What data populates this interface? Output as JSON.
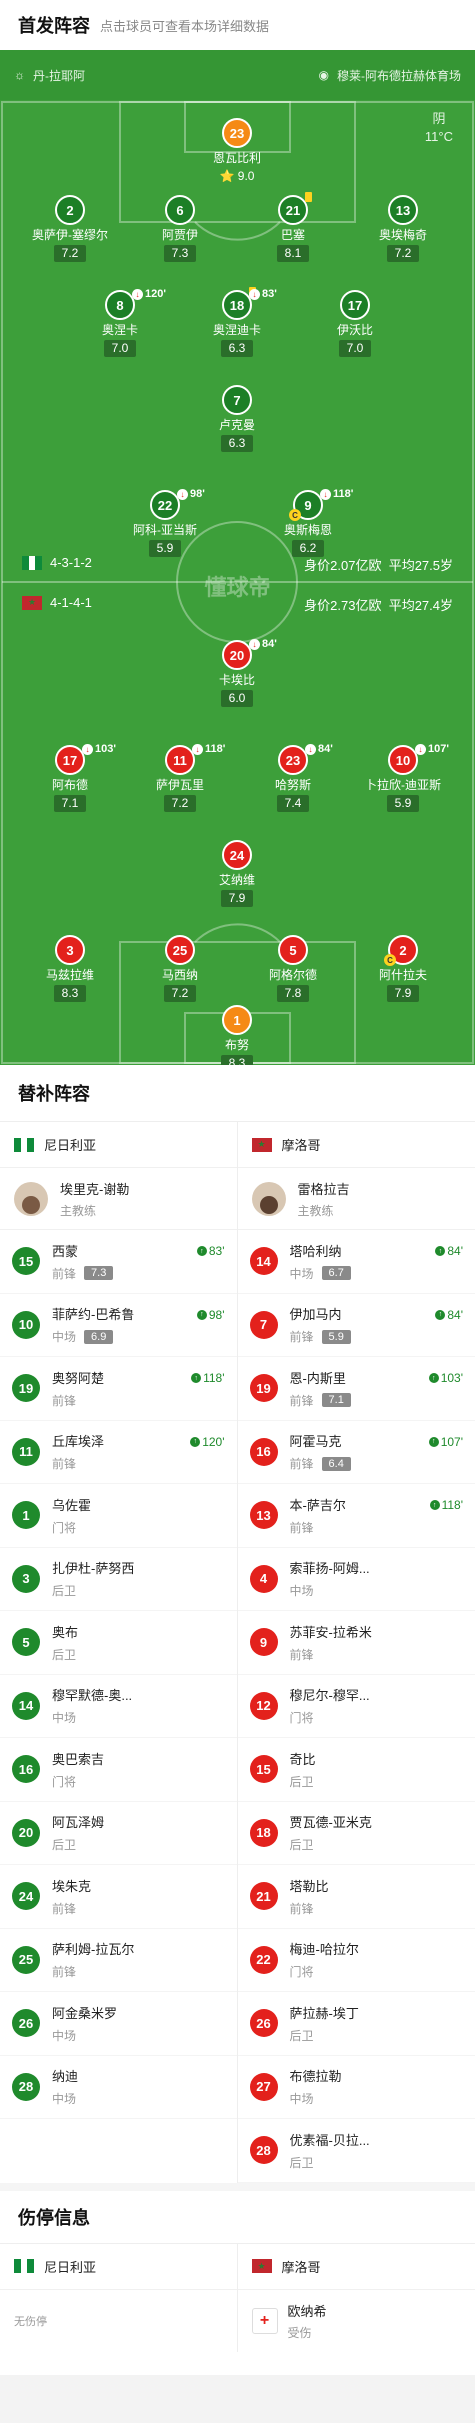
{
  "header": {
    "title": "首发阵容",
    "subtitle": "点击球员可查看本场详细数据"
  },
  "match": {
    "home_team": "丹-拉耶阿",
    "venue": "穆莱-阿布德拉赫体育场",
    "weather": "阴",
    "temperature": "11°C",
    "watermark": "懂球帝"
  },
  "home": {
    "formation": "4-3-1-2",
    "value": "身价2.07亿欧",
    "age": "平均27.5岁",
    "players": [
      {
        "num": "23",
        "name": "恩瓦比利",
        "rating": "9.0",
        "best": true
      },
      {
        "num": "2",
        "name": "奥萨伊-塞缪尔",
        "rating": "7.2"
      },
      {
        "num": "6",
        "name": "阿贾伊",
        "rating": "7.3"
      },
      {
        "num": "21",
        "name": "巴塞",
        "rating": "8.1",
        "yellow": true
      },
      {
        "num": "13",
        "name": "奥埃梅奇",
        "rating": "7.2"
      },
      {
        "num": "8",
        "name": "奥涅卡",
        "rating": "7.0",
        "sub": "120'"
      },
      {
        "num": "18",
        "name": "奥涅迪卡",
        "rating": "6.3",
        "sub": "83'",
        "yellow": true
      },
      {
        "num": "17",
        "name": "伊沃比",
        "rating": "7.0"
      },
      {
        "num": "7",
        "name": "卢克曼",
        "rating": "6.3"
      },
      {
        "num": "22",
        "name": "阿科-亚当斯",
        "rating": "5.9",
        "sub": "98'"
      },
      {
        "num": "9",
        "name": "奥斯梅恩",
        "rating": "6.2",
        "sub": "118'",
        "captain": "C"
      }
    ]
  },
  "away": {
    "formation": "4-1-4-1",
    "value": "身价2.73亿欧",
    "age": "平均27.4岁",
    "players": [
      {
        "num": "20",
        "name": "卡埃比",
        "rating": "6.0",
        "sub": "84'"
      },
      {
        "num": "17",
        "name": "阿布德",
        "rating": "7.1",
        "sub": "103'"
      },
      {
        "num": "11",
        "name": "萨伊瓦里",
        "rating": "7.2",
        "sub": "118'"
      },
      {
        "num": "23",
        "name": "哈努斯",
        "rating": "7.4",
        "sub": "84'"
      },
      {
        "num": "10",
        "name": "卜拉欣-迪亚斯",
        "rating": "5.9",
        "sub": "107'"
      },
      {
        "num": "24",
        "name": "艾纳维",
        "rating": "7.9"
      },
      {
        "num": "3",
        "name": "马兹拉维",
        "rating": "8.3"
      },
      {
        "num": "25",
        "name": "马西纳",
        "rating": "7.2"
      },
      {
        "num": "5",
        "name": "阿格尔德",
        "rating": "7.8"
      },
      {
        "num": "2",
        "name": "阿什拉夫",
        "rating": "7.9",
        "captain": "C"
      },
      {
        "num": "1",
        "name": "布努",
        "rating": "8.3",
        "keeper": true
      }
    ]
  },
  "subs": {
    "title": "替补阵容",
    "home_team": "尼日利亚",
    "away_team": "摩洛哥",
    "home_coach": {
      "name": "埃里克-谢勒",
      "role": "主教练"
    },
    "away_coach": {
      "name": "雷格拉吉",
      "role": "主教练"
    },
    "home": [
      {
        "num": "15",
        "name": "西蒙",
        "pos": "前锋",
        "rating": "7.3",
        "min": "83'"
      },
      {
        "num": "10",
        "name": "菲萨约-巴希鲁",
        "pos": "中场",
        "rating": "6.9",
        "min": "98'"
      },
      {
        "num": "19",
        "name": "奥努阿楚",
        "pos": "前锋",
        "rating": "",
        "min": "118'"
      },
      {
        "num": "11",
        "name": "丘库埃泽",
        "pos": "前锋",
        "rating": "",
        "min": "120'"
      },
      {
        "num": "1",
        "name": "乌佐霍",
        "pos": "门将",
        "rating": "",
        "min": ""
      },
      {
        "num": "3",
        "name": "扎伊杜-萨努西",
        "pos": "后卫",
        "rating": "",
        "min": ""
      },
      {
        "num": "5",
        "name": "奥布",
        "pos": "后卫",
        "rating": "",
        "min": ""
      },
      {
        "num": "14",
        "name": "穆罕默德-奥...",
        "pos": "中场",
        "rating": "",
        "min": ""
      },
      {
        "num": "16",
        "name": "奥巴索吉",
        "pos": "门将",
        "rating": "",
        "min": ""
      },
      {
        "num": "20",
        "name": "阿瓦泽姆",
        "pos": "后卫",
        "rating": "",
        "min": ""
      },
      {
        "num": "24",
        "name": "埃朱克",
        "pos": "前锋",
        "rating": "",
        "min": ""
      },
      {
        "num": "25",
        "name": "萨利姆-拉瓦尔",
        "pos": "前锋",
        "rating": "",
        "min": ""
      },
      {
        "num": "26",
        "name": "阿金桑米罗",
        "pos": "中场",
        "rating": "",
        "min": ""
      },
      {
        "num": "28",
        "name": "纳迪",
        "pos": "中场",
        "rating": "",
        "min": ""
      }
    ],
    "away": [
      {
        "num": "14",
        "name": "塔哈利纳",
        "pos": "中场",
        "rating": "6.7",
        "min": "84'"
      },
      {
        "num": "7",
        "name": "伊加马内",
        "pos": "前锋",
        "rating": "5.9",
        "min": "84'"
      },
      {
        "num": "19",
        "name": "恩-内斯里",
        "pos": "前锋",
        "rating": "7.1",
        "min": "103'"
      },
      {
        "num": "16",
        "name": "阿霍马克",
        "pos": "前锋",
        "rating": "6.4",
        "min": "107'"
      },
      {
        "num": "13",
        "name": "本-萨吉尔",
        "pos": "前锋",
        "rating": "",
        "min": "118'"
      },
      {
        "num": "4",
        "name": "索菲扬-阿姆...",
        "pos": "中场",
        "rating": "",
        "min": ""
      },
      {
        "num": "9",
        "name": "苏菲安-拉希米",
        "pos": "前锋",
        "rating": "",
        "min": ""
      },
      {
        "num": "12",
        "name": "穆尼尔-穆罕...",
        "pos": "门将",
        "rating": "",
        "min": ""
      },
      {
        "num": "15",
        "name": "奇比",
        "pos": "后卫",
        "rating": "",
        "min": ""
      },
      {
        "num": "18",
        "name": "贾瓦德-亚米克",
        "pos": "后卫",
        "rating": "",
        "min": ""
      },
      {
        "num": "21",
        "name": "塔勒比",
        "pos": "前锋",
        "rating": "",
        "min": ""
      },
      {
        "num": "22",
        "name": "梅迪-哈拉尔",
        "pos": "门将",
        "rating": "",
        "min": ""
      },
      {
        "num": "26",
        "name": "萨拉赫-埃丁",
        "pos": "后卫",
        "rating": "",
        "min": ""
      },
      {
        "num": "27",
        "name": "布德拉勒",
        "pos": "中场",
        "rating": "",
        "min": ""
      },
      {
        "num": "28",
        "name": "优素福-贝拉...",
        "pos": "后卫",
        "rating": "",
        "min": ""
      }
    ]
  },
  "injuries": {
    "title": "伤停信息",
    "home_team": "尼日利亚",
    "away_team": "摩洛哥",
    "home_text": "无伤停",
    "away_player": {
      "name": "欧纳希",
      "status": "受伤"
    }
  }
}
